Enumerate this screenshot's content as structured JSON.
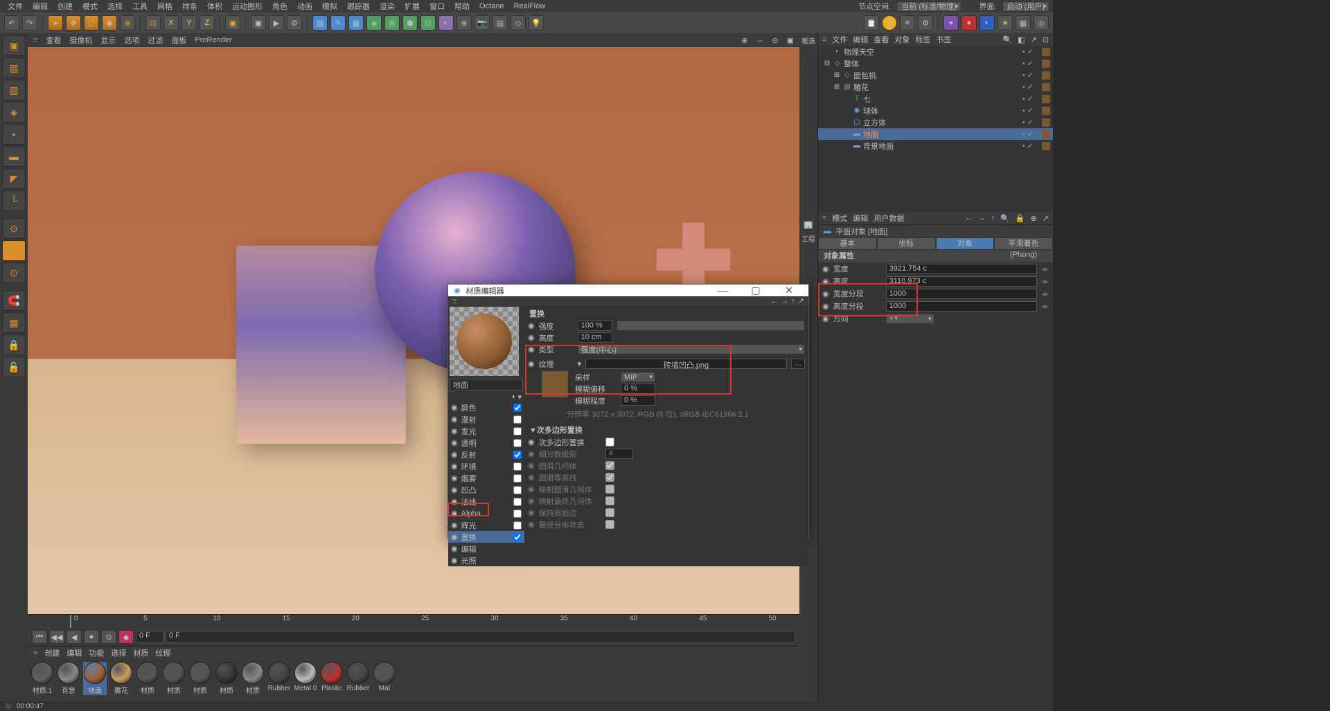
{
  "menubar": [
    "文件",
    "编辑",
    "创建",
    "模式",
    "选择",
    "工具",
    "网格",
    "样条",
    "体积",
    "运动图形",
    "角色",
    "动画",
    "模拟",
    "跟踪器",
    "渲染",
    "扩展",
    "窗口",
    "帮助",
    "Octane",
    "RealFlow"
  ],
  "topRight": {
    "label1": "节点空间:",
    "drop1": "当前 (标准/物理)",
    "label2": "界面:",
    "drop2": "启动 (用户)"
  },
  "viewHeader": [
    "查看",
    "摄像机",
    "显示",
    "选项",
    "过滤",
    "面板",
    "ProRender"
  ],
  "timeline": {
    "ticks": [
      "0",
      "5",
      "10",
      "15",
      "20",
      "25",
      "30",
      "35",
      "40",
      "45",
      "50"
    ],
    "fieldA": "0 F",
    "fieldB": "0 F"
  },
  "matPanelHeader": [
    "创建",
    "编辑",
    "功能",
    "选择",
    "材质",
    "纹理"
  ],
  "materials": [
    "材质.1",
    "背景",
    "地面",
    "雕花",
    "材质",
    "材质",
    "材质",
    "材质",
    "材质",
    "Rubber",
    "Metal 0",
    "Plastic",
    "Rubber",
    "Mat"
  ],
  "objHeader": [
    "文件",
    "编辑",
    "查看",
    "对象",
    "标签",
    "书签"
  ],
  "tree": [
    {
      "name": "物理天空",
      "indent": 0,
      "icon": "◐",
      "color": "#7aa0d0"
    },
    {
      "name": "整体",
      "indent": 0,
      "icon": "◇",
      "color": "#ff9040",
      "expand": "⊟"
    },
    {
      "name": "面包机",
      "indent": 1,
      "icon": "◇",
      "color": "#7aa0d0",
      "expand": "⊞"
    },
    {
      "name": "雕花",
      "indent": 1,
      "icon": "▧",
      "color": "#7aa0d0",
      "expand": "⊞"
    },
    {
      "name": "七",
      "indent": 2,
      "icon": "T",
      "color": "#50c070"
    },
    {
      "name": "球体",
      "indent": 2,
      "icon": "◉",
      "color": "#7aa0d0"
    },
    {
      "name": "立方体",
      "indent": 2,
      "icon": "▢",
      "color": "#7aa0d0"
    },
    {
      "name": "地面",
      "indent": 2,
      "icon": "▬",
      "color": "#7aa0d0",
      "selected": true
    },
    {
      "name": "背景地面",
      "indent": 2,
      "icon": "▬",
      "color": "#7aa0d0"
    }
  ],
  "attrHeader": [
    "模式",
    "编辑",
    "用户数据"
  ],
  "attrTitle": "平面对象 [地面]",
  "attrTabs": [
    "基本",
    "坐标",
    "对象",
    "平滑着色(Phong)"
  ],
  "attrSection": "对象属性",
  "attrs": [
    {
      "lbl": "宽度",
      "val": "3921.754 c"
    },
    {
      "lbl": "高度",
      "val": "3110.973 c"
    },
    {
      "lbl": "宽度分段",
      "val": "1000"
    },
    {
      "lbl": "高度分段",
      "val": "1000"
    },
    {
      "lbl": "方向",
      "val": "+Y",
      "dropdown": true
    }
  ],
  "matEditor": {
    "title": "材质编辑器",
    "name": "地面",
    "channels": [
      {
        "name": "颜色",
        "on": true
      },
      {
        "name": "漫射",
        "on": false
      },
      {
        "name": "发光",
        "on": false
      },
      {
        "name": "透明",
        "on": false
      },
      {
        "name": "反射",
        "on": true
      },
      {
        "name": "环境",
        "on": false
      },
      {
        "name": "烟雾",
        "on": false
      },
      {
        "name": "凹凸",
        "on": false
      },
      {
        "name": "法线",
        "on": false
      },
      {
        "name": "Alpha",
        "on": false
      },
      {
        "name": "辉光",
        "on": false
      },
      {
        "name": "置换",
        "on": true,
        "hl": true
      },
      {
        "name": "编辑",
        "on": null
      },
      {
        "name": "光照",
        "on": null
      }
    ],
    "section": "置换",
    "props": {
      "strength": {
        "lbl": "强度",
        "val": "100 %"
      },
      "height": {
        "lbl": "高度",
        "val": "10 cm"
      },
      "type": {
        "lbl": "类型",
        "val": "强度(中心)"
      },
      "tex": {
        "lbl": "纹理",
        "val": "砖墙凹凸.png",
        "browse": "…"
      },
      "sample": {
        "lbl": "采样",
        "val": "MIP"
      },
      "bluroff": {
        "lbl": "模糊偏移",
        "val": "0 %"
      },
      "blurscale": {
        "lbl": "模糊程度",
        "val": "0 %"
      },
      "info": "分辨率 3072 x 3072, RGB (8 位), sRGB IEC61966 2.1"
    },
    "subpoly": {
      "title": "▼次多边形置换",
      "rows": [
        {
          "lbl": "次多边形置换",
          "chk": false
        },
        {
          "lbl": "细分数级别",
          "val": "4",
          "disabled": true
        },
        {
          "lbl": "圆滑几何体",
          "chk": true,
          "disabled": true
        },
        {
          "lbl": "圆滑等高线",
          "chk": true,
          "disabled": true
        },
        {
          "lbl": "映射圆滑几何体",
          "chk": false,
          "disabled": true
        },
        {
          "lbl": "映射最终几何体",
          "chk": false,
          "disabled": true
        },
        {
          "lbl": "保持原始边",
          "chk": false,
          "disabled": true
        },
        {
          "lbl": "最佳分布状态",
          "chk": false,
          "disabled": true
        }
      ]
    }
  },
  "status": "00:00:47",
  "workLabel": "工程",
  "filterLabel": "框选"
}
